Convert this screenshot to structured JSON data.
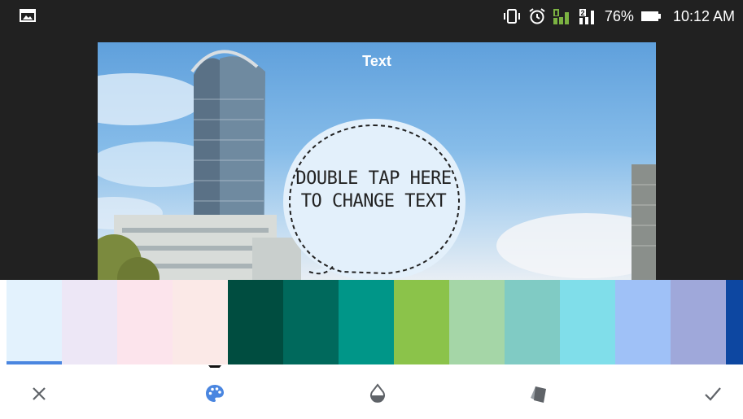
{
  "status_bar": {
    "battery": "76%",
    "time": "10:12 AM",
    "sim_label": "2",
    "icons": [
      "gallery-icon",
      "vibrate-icon",
      "alarm-icon",
      "signal-icon",
      "sim2-signal-icon",
      "battery-icon"
    ]
  },
  "editor": {
    "title": "Text",
    "bubble_lines": [
      "DOUBLE TAP HERE",
      "TO CHANGE TEXT"
    ]
  },
  "palette": {
    "selected_index": 0,
    "colors": [
      "#e3f2fd",
      "#ede7f6",
      "#fce4ec",
      "#fbe9e7",
      "#004d40",
      "#00695c",
      "#009688",
      "#8bc34a",
      "#a5d6a7",
      "#80cbc4",
      "#80deea",
      "#9fc1f7",
      "#9fa8da",
      "#0d47a1"
    ]
  },
  "toolbar": {
    "icons": [
      "close-icon",
      "palette-icon",
      "opacity-drop-icon",
      "style-cards-icon",
      "check-icon"
    ],
    "active": "palette-icon",
    "accent": "#4a86e0"
  }
}
